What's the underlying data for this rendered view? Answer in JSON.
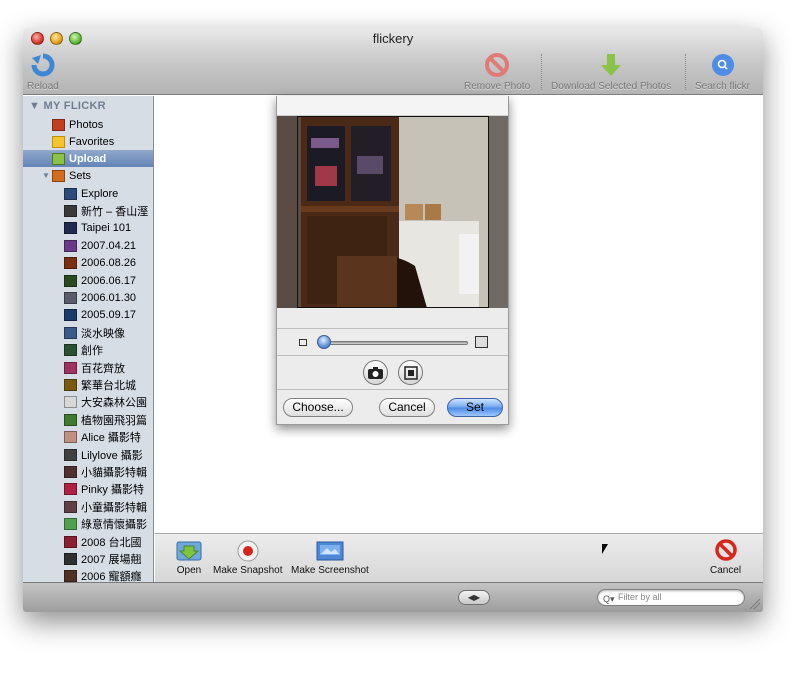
{
  "window": {
    "title": "flickery"
  },
  "toolbar": {
    "reload_label": "Reload",
    "remove_label": "Remove Photo",
    "download_label": "Download Selected Photos",
    "search_label": "Search flickr"
  },
  "sidebar": {
    "header": "MY FLICKR",
    "items": [
      {
        "label": "Photos",
        "icon": "photos-icon"
      },
      {
        "label": "Favorites",
        "icon": "favorites-star-icon"
      },
      {
        "label": "Upload",
        "icon": "upload-arrow-icon",
        "selected": true
      },
      {
        "label": "Sets",
        "icon": "sets-icon"
      }
    ],
    "sets": [
      "Explore",
      "新竹 – 香山溼",
      "Taipei 101",
      "2007.04.21",
      "2006.08.26",
      "2006.06.17",
      "2006.01.30",
      "2005.09.17",
      "淡水映像",
      "創作",
      "百花齊放",
      "繁華台北城",
      "大安森林公園",
      "植物園飛羽篇",
      "Alice 攝影特",
      "Lilylove 攝影",
      "小貓攝影特輯",
      "Pinky 攝影特",
      "小童攝影特輯",
      "綠意情懷攝影",
      "2008 台北國",
      "2007 展場翹",
      "2006 寵額癮"
    ]
  },
  "picture_taker": {
    "choose_label": "Choose...",
    "cancel_label": "Cancel",
    "set_label": "Set",
    "zoom_level": 0.05
  },
  "bottombar": {
    "open_label": "Open",
    "snapshot_label": "Make Snapshot",
    "screenshot_label": "Make Screenshot",
    "cancel_label": "Cancel"
  },
  "statusbar": {
    "filter_placeholder": "Filter by all"
  },
  "colors": {
    "selection": "#6484b7",
    "sidebar_bg": "#d6dde5",
    "cancel_red": "#d8261c",
    "search_blue": "#3e7ee0"
  }
}
